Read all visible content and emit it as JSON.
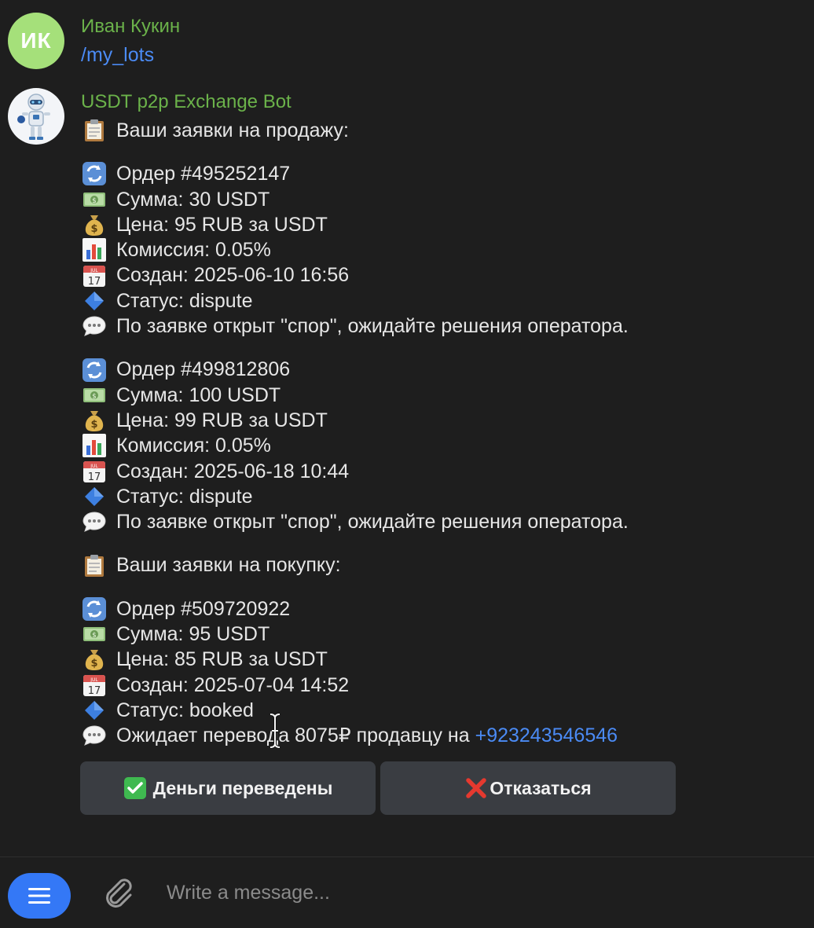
{
  "messages": [
    {
      "avatar_initials": "ИК",
      "sender": "Иван Кукин",
      "text": "/my_lots"
    },
    {
      "sender": "USDT p2p Exchange Bot",
      "sell_header": "Ваши заявки на продажу:",
      "buy_header": "Ваши заявки на покупку:",
      "sell_orders": [
        {
          "order": "Ордер #495252147",
          "amount": "Сумма: 30 USDT",
          "price": "Цена: 95 RUB за USDT",
          "fee": "Комиссия: 0.05%",
          "created": "Создан: 2025-06-10 16:56",
          "status": "Статус: dispute",
          "note": "По заявке открыт \"спор\", ожидайте решения оператора."
        },
        {
          "order": "Ордер #499812806",
          "amount": "Сумма: 100 USDT",
          "price": "Цена: 99 RUB за USDT",
          "fee": "Комиссия: 0.05%",
          "created": "Создан: 2025-06-18 10:44",
          "status": "Статус: dispute",
          "note": "По заявке открыт \"спор\", ожидайте решения оператора."
        }
      ],
      "buy_orders": [
        {
          "order": "Ордер #509720922",
          "amount": "Сумма: 95 USDT",
          "price": "Цена: 85 RUB за USDT",
          "created": "Создан: 2025-07-04 14:52",
          "status": "Статус: booked",
          "note_prefix": "Ожидает перевода 8075₽ продавцу на ",
          "phone": "+923243546546"
        }
      ],
      "buttons": {
        "confirm": "Деньги переведены",
        "decline": "Отказаться"
      }
    }
  ],
  "composer": {
    "placeholder": "Write a message..."
  },
  "colors": {
    "background": "#1e1e1e",
    "sender_name": "#6bb24a",
    "link": "#4b8bf5",
    "button_bg": "#3a3d42",
    "menu_button": "#3478f6",
    "avatar_ik": "#a5e07a"
  },
  "icons": [
    "clipboard-icon",
    "repeat-icon",
    "money-icon",
    "money-bag-icon",
    "bar-chart-icon",
    "calendar-icon",
    "blue-diamond-icon",
    "speech-bubble-icon",
    "check-mark-icon",
    "cross-mark-icon",
    "menu-icon",
    "paperclip-icon"
  ]
}
